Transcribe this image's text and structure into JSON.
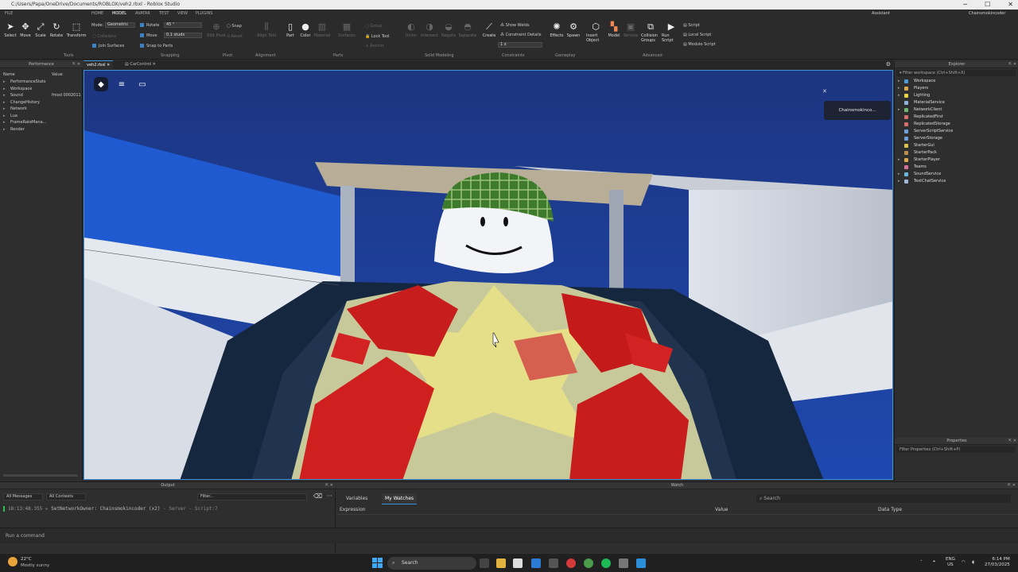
{
  "window": {
    "title": "C:/Users/Papa/OneDrive/Documents/ROBLOX/veh2.rbxl - Roblox Studio",
    "controls": [
      "─",
      "☐",
      "✕"
    ]
  },
  "menu": {
    "tabs": [
      "FILE",
      "HOME",
      "MODEL",
      "AVATAR",
      "TEST",
      "VIEW",
      "PLUGINS"
    ],
    "active_tab": "MODEL",
    "assistant": "Assistant",
    "user": "Chainsmokincoder"
  },
  "ribbon": {
    "tools": {
      "select": "Select",
      "move": "Move",
      "scale": "Scale",
      "rotate": "Rotate",
      "transform": "Transform",
      "group_label": "Tools"
    },
    "mode": {
      "label": "Mode:",
      "value": "Geometric"
    },
    "collisions": "Collisions",
    "join_surfaces": "Join Surfaces",
    "snapping": {
      "rotate_label": "Rotate",
      "rotate_value": "45 °",
      "move_label": "Move",
      "move_value": "0.1 studs",
      "snap_to_parts": "Snap to Parts",
      "group_label": "Snapping"
    },
    "pivot": {
      "edit_pivot": "Edit Pivot",
      "snap": "Snap",
      "reset": "Reset",
      "group_label": "Pivot"
    },
    "alignment": {
      "align_tool": "Align Tool",
      "group_label": "Alignment"
    },
    "parts": {
      "part": "Part",
      "color": "Color",
      "material": "Material",
      "surfaces": "Surfaces",
      "group": "Group",
      "lock_tool": "Lock Tool",
      "anchor": "Anchor",
      "group_label": "Parts"
    },
    "solid_modeling": {
      "union": "Union",
      "intersect": "Intersect",
      "negate": "Negate",
      "separate": "Separate",
      "group_label": "Solid Modeling"
    },
    "constraints": {
      "create": "Create",
      "show_welds": "Show Welds",
      "constraint_details": "Constraint Details",
      "scale": "1 x",
      "group_label": "Constraints"
    },
    "gameplay": {
      "effects": "Effects",
      "spawn": "Spawn",
      "insert_object": "Insert Object",
      "model": "Model",
      "service": "Service",
      "group_label": "Gameplay"
    },
    "advanced": {
      "collision_groups": "Collision Groups",
      "run_script": "Run Script",
      "script": "Script",
      "local_script": "Local Script",
      "module_script": "Module Script",
      "group_label": "Advanced"
    }
  },
  "performance": {
    "title": "Performance",
    "columns": {
      "name": "Name",
      "value": "Value"
    },
    "rows": [
      {
        "name": "PerformanceStats",
        "value": ""
      },
      {
        "name": "Workspace",
        "value": ""
      },
      {
        "name": "Sound",
        "value": "fmod 0002011"
      },
      {
        "name": "ChangeHistory",
        "value": ""
      },
      {
        "name": "Network",
        "value": ""
      },
      {
        "name": "Lua",
        "value": ""
      },
      {
        "name": "FrameRateMana...",
        "value": ""
      },
      {
        "name": "Render",
        "value": ""
      }
    ]
  },
  "doc_tabs": [
    {
      "label": "veh2.rbxl",
      "active": true
    },
    {
      "label": "CarControl",
      "active": false
    }
  ],
  "viewport": {
    "notification": "Chainsmokinco...",
    "notification_close": "✕",
    "icons": [
      "roblox-logo-icon",
      "menu-icon",
      "chat-icon"
    ]
  },
  "explorer": {
    "title": "Explorer",
    "filter_placeholder": "Filter workspace (Ctrl+Shift+X)",
    "items": [
      {
        "name": "Workspace",
        "expandable": true,
        "color": "#4f9ad8"
      },
      {
        "name": "Players",
        "expandable": true,
        "color": "#d8a84f"
      },
      {
        "name": "Lighting",
        "expandable": true,
        "color": "#e8d44a"
      },
      {
        "name": "MaterialService",
        "expandable": false,
        "color": "#8fb3d8"
      },
      {
        "name": "NetworkClient",
        "expandable": true,
        "color": "#6fb66f"
      },
      {
        "name": "ReplicatedFirst",
        "expandable": false,
        "color": "#d86f6f"
      },
      {
        "name": "ReplicatedStorage",
        "expandable": false,
        "color": "#d86f6f"
      },
      {
        "name": "ServerScriptService",
        "expandable": false,
        "color": "#6f9fd8"
      },
      {
        "name": "ServerStorage",
        "expandable": false,
        "color": "#6f9fd8"
      },
      {
        "name": "StarterGui",
        "expandable": false,
        "color": "#d8c44f"
      },
      {
        "name": "StarterPack",
        "expandable": false,
        "color": "#b88f4f"
      },
      {
        "name": "StarterPlayer",
        "expandable": true,
        "color": "#d8a84f"
      },
      {
        "name": "Teams",
        "expandable": false,
        "color": "#d86f9f"
      },
      {
        "name": "SoundService",
        "expandable": true,
        "color": "#6fb6d8"
      },
      {
        "name": "TextChatService",
        "expandable": true,
        "color": "#9fb6d8"
      }
    ]
  },
  "properties": {
    "title": "Properties",
    "filter_placeholder": "Filter Properties (Ctrl+Shift+P)"
  },
  "output": {
    "title": "Output",
    "messages_filter": "All Messages",
    "contexts_filter": "All Contexts",
    "filter_placeholder": "Filter...",
    "log": {
      "time": "18:13:48.355",
      "message": "SetNetworkOwner: Chainsmokincoder (x2)",
      "source": "Server - Script:7"
    }
  },
  "command_bar": {
    "placeholder": "Run a command"
  },
  "watch": {
    "title": "Watch",
    "tabs": [
      "Variables",
      "My Watches"
    ],
    "active_tab": "My Watches",
    "search_placeholder": "Search",
    "columns": [
      "Expression",
      "Value",
      "Data Type"
    ]
  },
  "taskbar": {
    "weather_temp": "22°C",
    "weather_desc": "Mostly sunny",
    "search": "Search",
    "lang": "ENG",
    "region": "US",
    "time": "6:14 PM",
    "date": "27/03/2025"
  }
}
